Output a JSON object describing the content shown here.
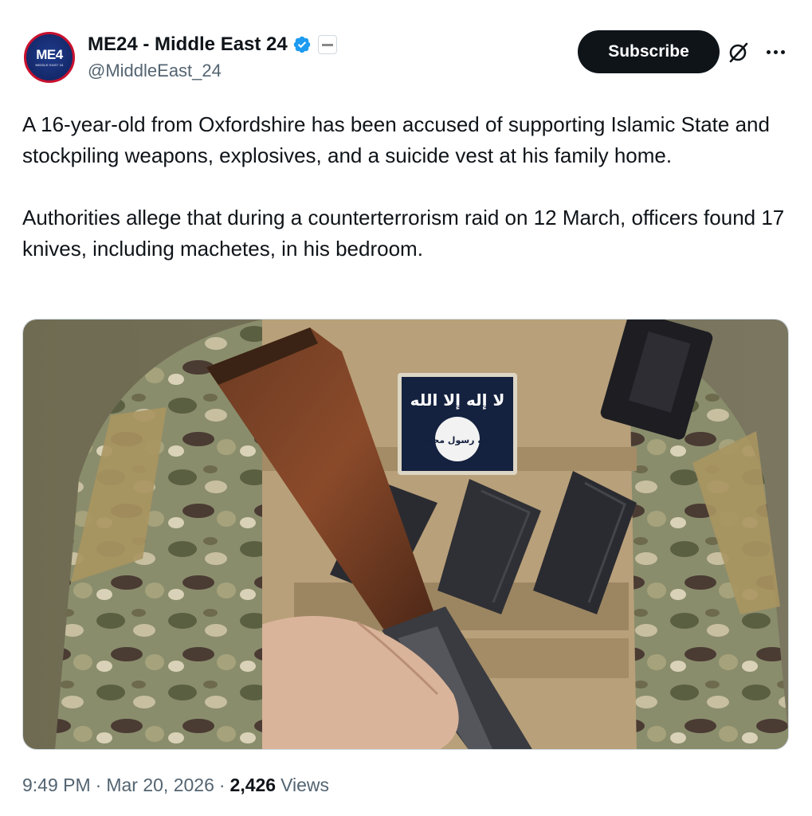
{
  "author": {
    "display_name": "ME24 - Middle East 24",
    "handle": "@MiddleEast_24",
    "avatar_text": "ME4",
    "avatar_subtext": "MIDDLE EAST 24",
    "verified_icon": "verified-badge-icon",
    "brand_color": "#1d9bf0"
  },
  "actions": {
    "subscribe_label": "Subscribe",
    "grok_icon": "grok-icon",
    "more_icon": "more-icon"
  },
  "tweet": {
    "paragraph_1": "A 16-year-old from Oxfordshire has been accused of supporting Islamic State and stockpiling weapons, explosives, and a suicide vest at his family home.",
    "paragraph_2": "Authorities allege that during a counterterrorism raid on 12 March, officers found 17 knives, including machetes, in his bedroom."
  },
  "media": {
    "patch_text_top": "لا إله إلا الله",
    "patch_text_circle": "الله رسول محمد"
  },
  "meta": {
    "time": "9:49 PM",
    "date": "Mar 20, 2026",
    "views_count": "2,426",
    "views_label": "Views"
  }
}
